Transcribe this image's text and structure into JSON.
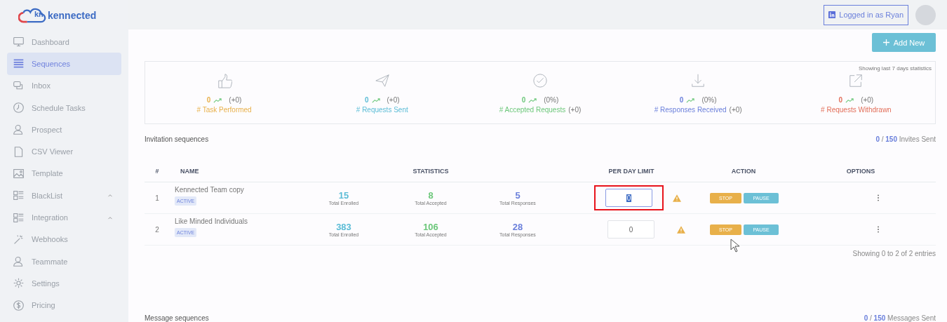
{
  "logo": {
    "mark": "kn",
    "text": "kennected"
  },
  "sidebar": {
    "items": [
      {
        "label": "Dashboard",
        "selected": false
      },
      {
        "label": "Sequences",
        "selected": true
      },
      {
        "label": "Inbox",
        "selected": false
      },
      {
        "label": "Schedule Tasks",
        "selected": false
      },
      {
        "label": "Prospect",
        "selected": false
      },
      {
        "label": "CSV Viewer",
        "selected": false
      },
      {
        "label": "Template",
        "selected": false
      },
      {
        "label": "BlackList",
        "selected": false,
        "expanded": true
      },
      {
        "label": "Integration",
        "selected": false,
        "expanded": true
      },
      {
        "label": "Webhooks",
        "selected": false
      },
      {
        "label": "Teammate",
        "selected": false
      },
      {
        "label": "Settings",
        "selected": false
      },
      {
        "label": "Pricing",
        "selected": false
      }
    ]
  },
  "header": {
    "login": "Logged in as Ryan"
  },
  "add_button": "Add New",
  "stats": {
    "note": "Showing last 7 days statistics",
    "cards": [
      {
        "value": "0",
        "change": "(+0)",
        "label": "# Task Performed",
        "color": "#e8b04a"
      },
      {
        "value": "0",
        "change": "(+0)",
        "label": "# Requests Sent",
        "color": "#5bbcd6"
      },
      {
        "value": "0",
        "change": "(0%)",
        "label": "# Accepted Requests",
        "extra": "(+0)",
        "color": "#6cc77a"
      },
      {
        "value": "0",
        "change": "(0%)",
        "label": "# Responses Received",
        "extra": "(+0)",
        "color": "#6a7fdb"
      },
      {
        "value": "0",
        "change": "(+0)",
        "label": "# Requests Withdrawn",
        "color": "#e26f5a"
      }
    ]
  },
  "invitations": {
    "title": "Invitation sequences",
    "sent": "0",
    "separator": "/",
    "limit": "150",
    "sent_label": "Invites Sent",
    "columns": [
      "#",
      "NAME",
      "STATISTICS",
      "PER DAY LIMIT",
      "ACTION",
      "OPTIONS"
    ],
    "rows": [
      {
        "index": "1",
        "name": "Kennected Team copy",
        "status": "ACTIVE",
        "limit": "0",
        "focused": true,
        "highlighted": true,
        "actions": [
          "STOP",
          "PAUSE"
        ],
        "stats": [
          {
            "value": "15",
            "label": "Total Enrolled",
            "color": "#5bbcd6"
          },
          {
            "value": "8",
            "label": "Total Accepted",
            "color": "#6cc77a"
          },
          {
            "value": "5",
            "label": "Total Responses",
            "color": "#6a7fdb"
          }
        ]
      },
      {
        "index": "2",
        "name": "Like Minded Individuals",
        "status": "ACTIVE",
        "limit": "0",
        "focused": false,
        "highlighted": false,
        "actions": [
          "STOP",
          "PAUSE"
        ],
        "stats": [
          {
            "value": "383",
            "label": "Total Enrolled",
            "color": "#5bbcd6"
          },
          {
            "value": "106",
            "label": "Total Accepted",
            "color": "#6cc77a"
          },
          {
            "value": "28",
            "label": "Total Responses",
            "color": "#6a7fdb"
          }
        ]
      }
    ],
    "footer": "Showing 0 to 2 of 2 entries"
  },
  "messages": {
    "title": "Message sequences",
    "sent": "0",
    "separator": "/",
    "limit": "150",
    "sent_label": "Messages Sent"
  }
}
